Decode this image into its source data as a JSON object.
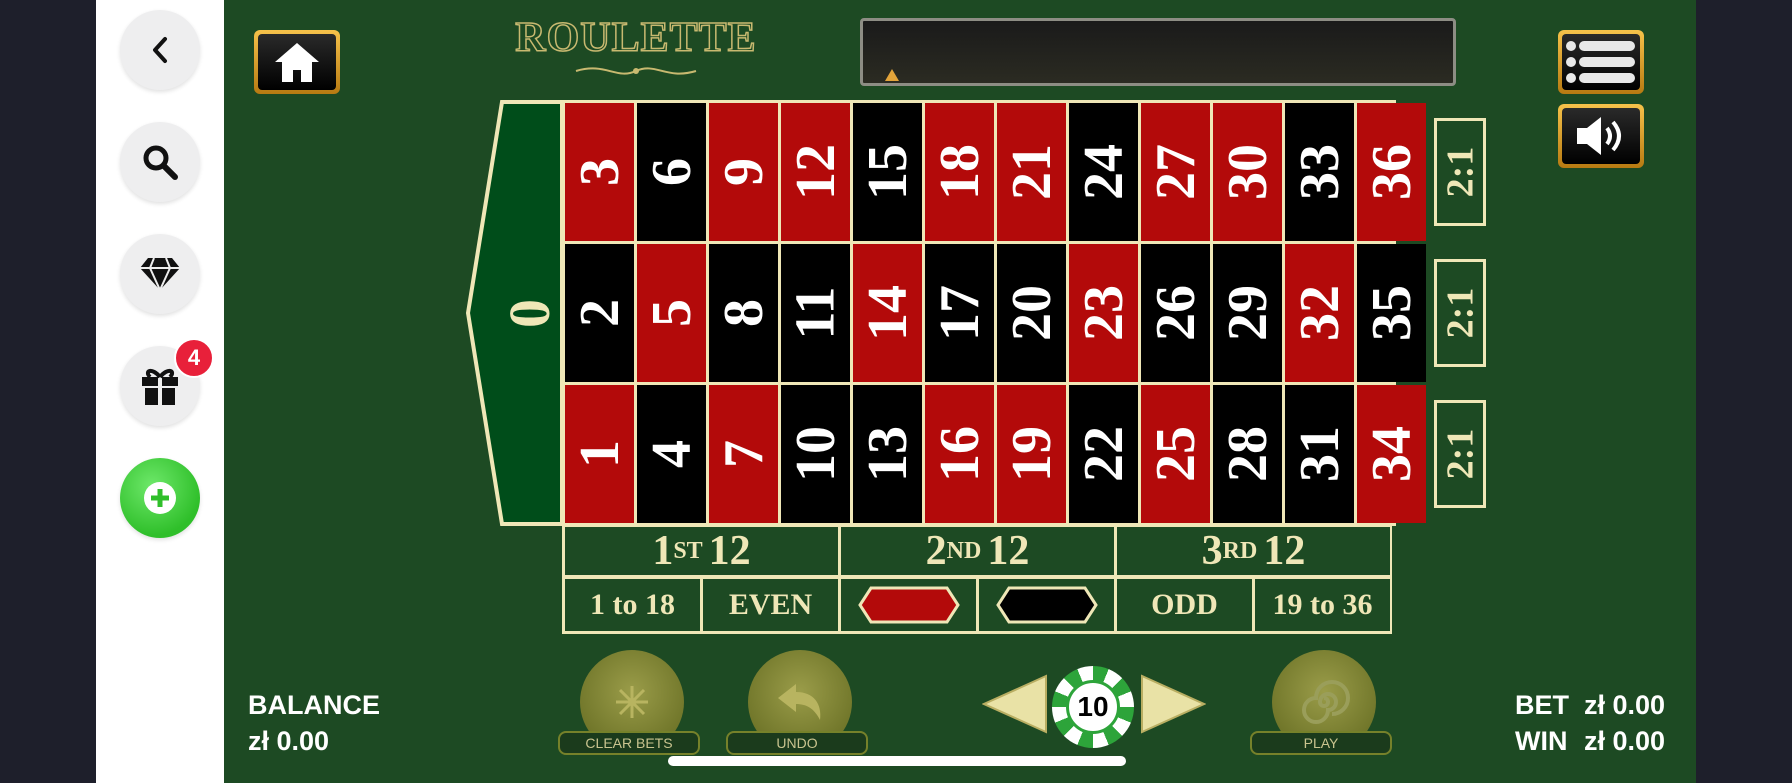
{
  "sidebar": {
    "back": {
      "icon": "chevron-left-icon"
    },
    "search": {
      "icon": "search-icon"
    },
    "vip": {
      "icon": "diamond-icon"
    },
    "gift": {
      "icon": "gift-icon",
      "badge": "4"
    },
    "deposit": {
      "icon": "plus-icon"
    }
  },
  "header": {
    "home_icon": "home-icon",
    "logo": "ROULETTE",
    "message": "",
    "menu_icon": "menu-list-icon",
    "sound_icon": "speaker-icon"
  },
  "table": {
    "zero": "0",
    "top_row": [
      {
        "n": "3",
        "c": "red"
      },
      {
        "n": "6",
        "c": "black"
      },
      {
        "n": "9",
        "c": "red"
      },
      {
        "n": "12",
        "c": "red"
      },
      {
        "n": "15",
        "c": "black"
      },
      {
        "n": "18",
        "c": "red"
      },
      {
        "n": "21",
        "c": "red"
      },
      {
        "n": "24",
        "c": "black"
      },
      {
        "n": "27",
        "c": "red"
      },
      {
        "n": "30",
        "c": "red"
      },
      {
        "n": "33",
        "c": "black"
      },
      {
        "n": "36",
        "c": "red"
      }
    ],
    "middle_row": [
      {
        "n": "2",
        "c": "black"
      },
      {
        "n": "5",
        "c": "red"
      },
      {
        "n": "8",
        "c": "black"
      },
      {
        "n": "11",
        "c": "black"
      },
      {
        "n": "14",
        "c": "red"
      },
      {
        "n": "17",
        "c": "black"
      },
      {
        "n": "20",
        "c": "black"
      },
      {
        "n": "23",
        "c": "red"
      },
      {
        "n": "26",
        "c": "black"
      },
      {
        "n": "29",
        "c": "black"
      },
      {
        "n": "32",
        "c": "red"
      },
      {
        "n": "35",
        "c": "black"
      }
    ],
    "bottom_row": [
      {
        "n": "1",
        "c": "red"
      },
      {
        "n": "4",
        "c": "black"
      },
      {
        "n": "7",
        "c": "red"
      },
      {
        "n": "10",
        "c": "black"
      },
      {
        "n": "13",
        "c": "black"
      },
      {
        "n": "16",
        "c": "red"
      },
      {
        "n": "19",
        "c": "red"
      },
      {
        "n": "22",
        "c": "black"
      },
      {
        "n": "25",
        "c": "red"
      },
      {
        "n": "28",
        "c": "black"
      },
      {
        "n": "31",
        "c": "black"
      },
      {
        "n": "34",
        "c": "red"
      }
    ],
    "column_bets": [
      "2:1",
      "2:1",
      "2:1"
    ],
    "dozens": [
      {
        "num": "1",
        "sup": "ST",
        "rest": "12"
      },
      {
        "num": "2",
        "sup": "ND",
        "rest": "12"
      },
      {
        "num": "3",
        "sup": "RD",
        "rest": "12"
      }
    ],
    "outside": {
      "low": "1 to 18",
      "even": "EVEN",
      "odd": "ODD",
      "high": "19 to 36"
    }
  },
  "footer": {
    "balance_label": "BALANCE",
    "balance_value": "zł 0.00",
    "clear_bets": "CLEAR BETS",
    "undo": "UNDO",
    "chip_value": "10",
    "play": "PLAY",
    "bet_label": "BET",
    "bet_value": "zł 0.00",
    "win_label": "WIN",
    "win_value": "zł 0.00"
  },
  "colors": {
    "felt": "#1d4a23",
    "red": "#b30a0a",
    "black": "#000000",
    "cream": "#efe7b7",
    "gold": "#f6c24a",
    "badge": "#e8203a"
  }
}
